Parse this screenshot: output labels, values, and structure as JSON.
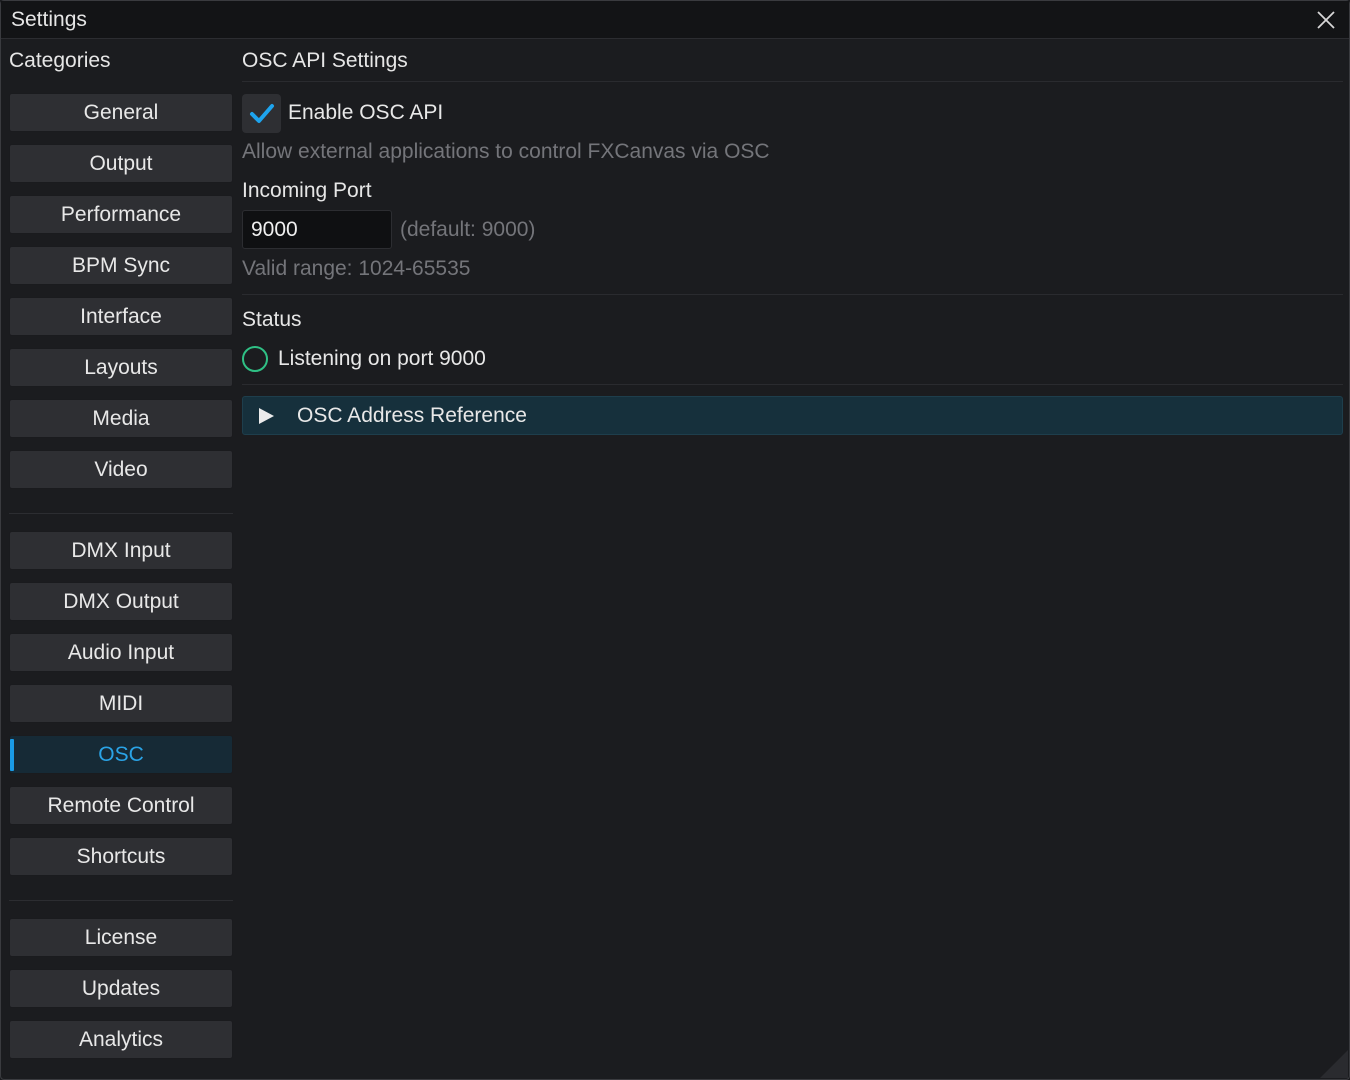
{
  "window": {
    "title": "Settings"
  },
  "sidebar": {
    "header": "Categories",
    "groups": [
      [
        {
          "label": "General"
        },
        {
          "label": "Output"
        },
        {
          "label": "Performance"
        },
        {
          "label": "BPM Sync"
        },
        {
          "label": "Interface"
        },
        {
          "label": "Layouts"
        },
        {
          "label": "Media"
        },
        {
          "label": "Video"
        }
      ],
      [
        {
          "label": "DMX Input"
        },
        {
          "label": "DMX Output"
        },
        {
          "label": "Audio Input"
        },
        {
          "label": "MIDI"
        },
        {
          "label": "OSC",
          "active": true
        },
        {
          "label": "Remote Control"
        },
        {
          "label": "Shortcuts"
        }
      ],
      [
        {
          "label": "License"
        },
        {
          "label": "Updates"
        },
        {
          "label": "Analytics"
        }
      ]
    ]
  },
  "main": {
    "section_title": "OSC API Settings",
    "enable_checkbox": {
      "label": "Enable OSC API",
      "checked": true
    },
    "enable_hint": "Allow external applications to control FXCanvas via OSC",
    "port": {
      "label": "Incoming Port",
      "value": "9000",
      "default_hint": "(default: 9000)",
      "range_hint": "Valid range: 1024-65535"
    },
    "status": {
      "label": "Status",
      "text": "Listening on port 9000",
      "icon": "status-ring-icon"
    },
    "reference": {
      "label": "OSC Address Reference",
      "expanded": false
    }
  },
  "colors": {
    "accent": "#1a9be6",
    "status_ok": "#2fc085",
    "background": "#1b1c1f",
    "button": "#2e2f33"
  }
}
